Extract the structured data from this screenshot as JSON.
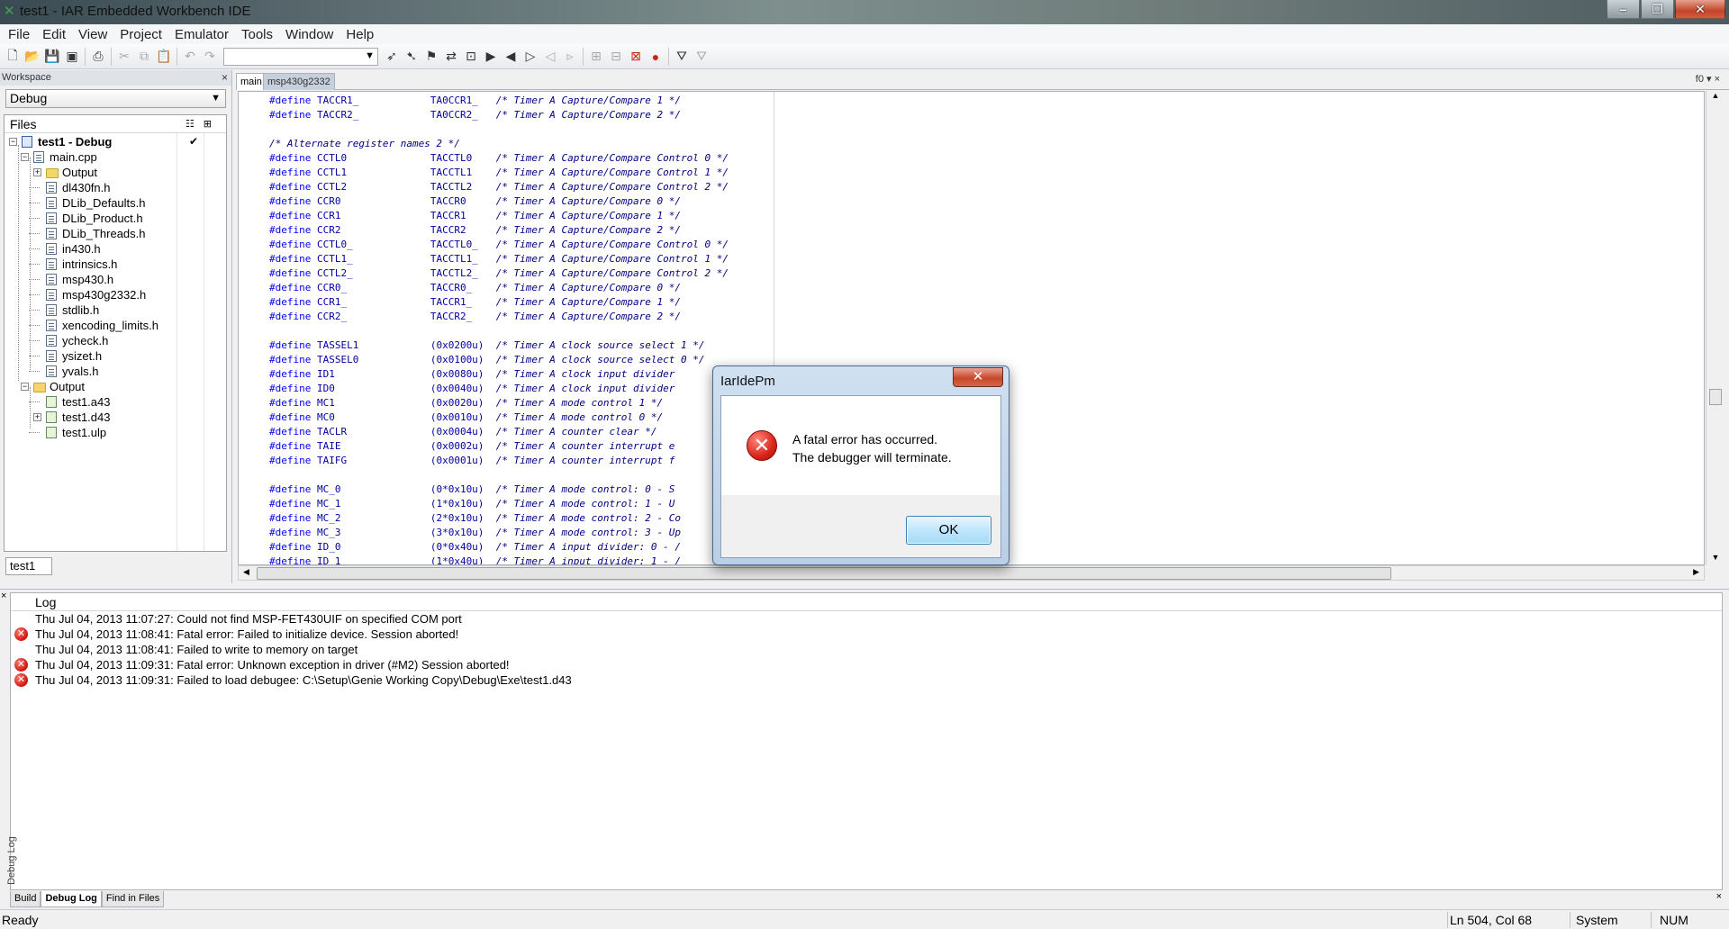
{
  "window": {
    "title": "test1 - IAR Embedded Workbench IDE"
  },
  "menu": [
    "File",
    "Edit",
    "View",
    "Project",
    "Emulator",
    "Tools",
    "Window",
    "Help"
  ],
  "workspace": {
    "header": "Workspace",
    "config": "Debug",
    "files_header": "Files",
    "tab": "test1",
    "tree": [
      {
        "label": "test1 - Debug",
        "type": "project",
        "bold": true
      },
      {
        "label": "main.cpp",
        "type": "file"
      },
      {
        "label": "Output",
        "type": "folder"
      },
      {
        "label": "dl430fn.h",
        "type": "file"
      },
      {
        "label": "DLib_Defaults.h",
        "type": "file"
      },
      {
        "label": "DLib_Product.h",
        "type": "file"
      },
      {
        "label": "DLib_Threads.h",
        "type": "file"
      },
      {
        "label": "in430.h",
        "type": "file"
      },
      {
        "label": "intrinsics.h",
        "type": "file"
      },
      {
        "label": "msp430.h",
        "type": "file"
      },
      {
        "label": "msp430g2332.h",
        "type": "file"
      },
      {
        "label": "stdlib.h",
        "type": "file"
      },
      {
        "label": "xencoding_limits.h",
        "type": "file"
      },
      {
        "label": "ycheck.h",
        "type": "file"
      },
      {
        "label": "ysizet.h",
        "type": "file"
      },
      {
        "label": "yvals.h",
        "type": "file"
      },
      {
        "label": "Output",
        "type": "folder"
      },
      {
        "label": "test1.a43",
        "type": "obj"
      },
      {
        "label": "test1.d43",
        "type": "obj"
      },
      {
        "label": "test1.ulp",
        "type": "obj"
      }
    ]
  },
  "editor": {
    "tabs": [
      "main",
      "msp430g2332"
    ],
    "tab_controls": "f0 ▾ ×",
    "lines": [
      {
        "kw": "#define",
        "name": "TACCR1_",
        "val": "TA0CCR1_",
        "cm": "/* Timer A Capture/Compare 1 */"
      },
      {
        "kw": "#define",
        "name": "TACCR2_",
        "val": "TA0CCR2_",
        "cm": "/* Timer A Capture/Compare 2 */"
      },
      {
        "kw": "",
        "name": "",
        "val": "",
        "cm": ""
      },
      {
        "kw": "",
        "name": "",
        "val": "",
        "cm": "/* Alternate register names 2 */"
      },
      {
        "kw": "#define",
        "name": "CCTL0",
        "val": "TACCTL0",
        "cm": "/* Timer A Capture/Compare Control 0 */"
      },
      {
        "kw": "#define",
        "name": "CCTL1",
        "val": "TACCTL1",
        "cm": "/* Timer A Capture/Compare Control 1 */"
      },
      {
        "kw": "#define",
        "name": "CCTL2",
        "val": "TACCTL2",
        "cm": "/* Timer A Capture/Compare Control 2 */"
      },
      {
        "kw": "#define",
        "name": "CCR0",
        "val": "TACCR0",
        "cm": "/* Timer A Capture/Compare 0 */"
      },
      {
        "kw": "#define",
        "name": "CCR1",
        "val": "TACCR1",
        "cm": "/* Timer A Capture/Compare 1 */"
      },
      {
        "kw": "#define",
        "name": "CCR2",
        "val": "TACCR2",
        "cm": "/* Timer A Capture/Compare 2 */"
      },
      {
        "kw": "#define",
        "name": "CCTL0_",
        "val": "TACCTL0_",
        "cm": "/* Timer A Capture/Compare Control 0 */"
      },
      {
        "kw": "#define",
        "name": "CCTL1_",
        "val": "TACCTL1_",
        "cm": "/* Timer A Capture/Compare Control 1 */"
      },
      {
        "kw": "#define",
        "name": "CCTL2_",
        "val": "TACCTL2_",
        "cm": "/* Timer A Capture/Compare Control 2 */"
      },
      {
        "kw": "#define",
        "name": "CCR0_",
        "val": "TACCR0_",
        "cm": "/* Timer A Capture/Compare 0 */"
      },
      {
        "kw": "#define",
        "name": "CCR1_",
        "val": "TACCR1_",
        "cm": "/* Timer A Capture/Compare 1 */"
      },
      {
        "kw": "#define",
        "name": "CCR2_",
        "val": "TACCR2_",
        "cm": "/* Timer A Capture/Compare 2 */"
      },
      {
        "kw": "",
        "name": "",
        "val": "",
        "cm": ""
      },
      {
        "kw": "#define",
        "name": "TASSEL1",
        "val": "(0x0200u)",
        "cm": "/* Timer A clock source select 1 */"
      },
      {
        "kw": "#define",
        "name": "TASSEL0",
        "val": "(0x0100u)",
        "cm": "/* Timer A clock source select 0 */"
      },
      {
        "kw": "#define",
        "name": "ID1",
        "val": "(0x0080u)",
        "cm": "/* Timer A clock input divider"
      },
      {
        "kw": "#define",
        "name": "ID0",
        "val": "(0x0040u)",
        "cm": "/* Timer A clock input divider"
      },
      {
        "kw": "#define",
        "name": "MC1",
        "val": "(0x0020u)",
        "cm": "/* Timer A mode control 1 */"
      },
      {
        "kw": "#define",
        "name": "MC0",
        "val": "(0x0010u)",
        "cm": "/* Timer A mode control 0 */"
      },
      {
        "kw": "#define",
        "name": "TACLR",
        "val": "(0x0004u)",
        "cm": "/* Timer A counter clear */"
      },
      {
        "kw": "#define",
        "name": "TAIE",
        "val": "(0x0002u)",
        "cm": "/* Timer A counter interrupt e"
      },
      {
        "kw": "#define",
        "name": "TAIFG",
        "val": "(0x0001u)",
        "cm": "/* Timer A counter interrupt f"
      },
      {
        "kw": "",
        "name": "",
        "val": "",
        "cm": ""
      },
      {
        "kw": "#define",
        "name": "MC_0",
        "val": "(0*0x10u)",
        "cm": "/* Timer A mode control: 0 - S"
      },
      {
        "kw": "#define",
        "name": "MC_1",
        "val": "(1*0x10u)",
        "cm": "/* Timer A mode control: 1 - U"
      },
      {
        "kw": "#define",
        "name": "MC_2",
        "val": "(2*0x10u)",
        "cm": "/* Timer A mode control: 2 - Co"
      },
      {
        "kw": "#define",
        "name": "MC_3",
        "val": "(3*0x10u)",
        "cm": "/* Timer A mode control: 3 - Up"
      },
      {
        "kw": "#define",
        "name": "ID_0",
        "val": "(0*0x40u)",
        "cm": "/* Timer A input divider: 0 - /"
      },
      {
        "kw": "#define",
        "name": "ID_1",
        "val": "(1*0x40u)",
        "cm": "/* Timer A input divider: 1 - /"
      }
    ]
  },
  "log": {
    "header": "Log",
    "entries": [
      {
        "error": false,
        "text": "Thu Jul 04, 2013 11:07:27: Could not find MSP-FET430UIF on specified COM port"
      },
      {
        "error": true,
        "text": "Thu Jul 04, 2013 11:08:41: Fatal error: Failed to initialize device.   Session aborted!"
      },
      {
        "error": false,
        "text": "Thu Jul 04, 2013 11:08:41: Failed to write to memory on target"
      },
      {
        "error": true,
        "text": "Thu Jul 04, 2013 11:09:31: Fatal error: Unknown exception in driver (#M2)   Session aborted!"
      },
      {
        "error": true,
        "text": "Thu Jul 04, 2013 11:09:31: Failed to load debugee: C:\\Setup\\Genie Working Copy\\Debug\\Exe\\test1.d43"
      }
    ],
    "side_label": "Debug Log",
    "tabs": [
      "Build",
      "Debug Log",
      "Find in Files"
    ],
    "active_tab": 1
  },
  "status": {
    "ready": "Ready",
    "position": "Ln 504, Col 68",
    "mode": "System",
    "num": "NUM"
  },
  "dialog": {
    "title": "IarIdePm",
    "line1": "A fatal error has occurred.",
    "line2": "The debugger will terminate.",
    "ok": "OK",
    "icon": "error-icon"
  }
}
